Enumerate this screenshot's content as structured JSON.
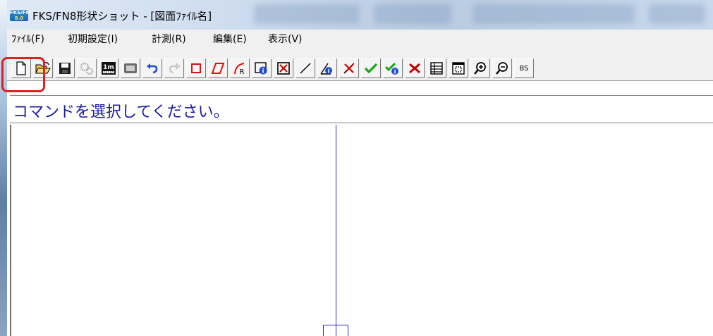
{
  "window": {
    "title": "FKS/FN8形状ショット - [図面ﾌｧｲﾙ名]",
    "icon_top": "FKS/FN",
    "icon_bottom": "8.0"
  },
  "menubar": {
    "items": [
      {
        "label": "ﾌｧｲﾙ(F)"
      },
      {
        "label": "初期設定(I)"
      },
      {
        "label": "計測(R)"
      },
      {
        "label": "編集(E)"
      },
      {
        "label": "表示(V)"
      }
    ]
  },
  "toolbar": {
    "buttons": [
      {
        "icon": "new-file-icon",
        "enabled": true
      },
      {
        "icon": "open-folder-icon",
        "enabled": true
      },
      {
        "icon": "save-icon",
        "enabled": true
      },
      {
        "icon": "settings-gear-icon",
        "enabled": false
      },
      {
        "icon": "measure-1m-icon",
        "enabled": true,
        "label": "1m"
      },
      {
        "icon": "display-icon",
        "enabled": true
      },
      {
        "icon": "undo-icon",
        "enabled": true
      },
      {
        "icon": "redo-icon",
        "enabled": false
      },
      {
        "icon": "rectangle-icon",
        "enabled": true
      },
      {
        "icon": "parallelogram-icon",
        "enabled": true
      },
      {
        "icon": "arc-r-icon",
        "enabled": true
      },
      {
        "icon": "info-shape-icon",
        "enabled": true
      },
      {
        "icon": "delete-box-icon",
        "enabled": true
      },
      {
        "icon": "line-icon",
        "enabled": true
      },
      {
        "icon": "angle-info-icon",
        "enabled": true
      },
      {
        "icon": "cancel-line-icon",
        "enabled": true
      },
      {
        "icon": "check-icon",
        "enabled": true
      },
      {
        "icon": "check-info-icon",
        "enabled": true
      },
      {
        "icon": "reject-icon",
        "enabled": true
      },
      {
        "icon": "list-icon",
        "enabled": true
      },
      {
        "icon": "fit-window-icon",
        "enabled": true
      },
      {
        "icon": "zoom-in-icon",
        "enabled": true
      },
      {
        "icon": "zoom-out-icon",
        "enabled": true
      },
      {
        "icon": "bs-icon",
        "enabled": true,
        "label": "BS"
      }
    ]
  },
  "status": {
    "message": "コマンドを選択してください。"
  },
  "colors": {
    "highlight": "#e21f1f",
    "status_text": "#1a1aa6",
    "drawing_line": "#2a2ad0"
  }
}
